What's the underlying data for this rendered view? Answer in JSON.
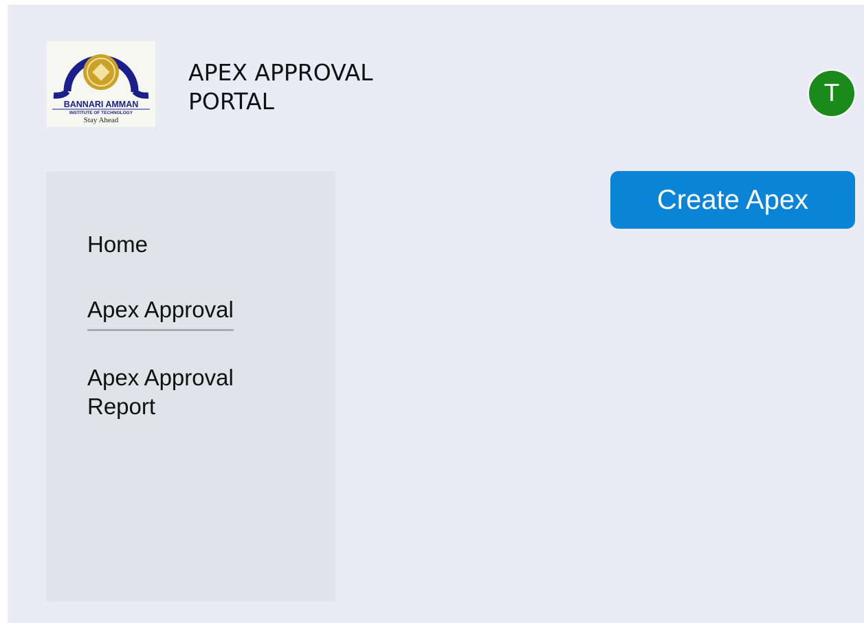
{
  "header": {
    "logo": {
      "icon": "omega-logo-icon",
      "name": "BANNARI AMMAN",
      "subtitle": "INSTITUTE OF TECHNOLOGY",
      "tagline": "Stay Ahead"
    },
    "title": "APEX APPROVAL\nPORTAL",
    "avatar_initial": "T",
    "avatar_color": "#1a8a1a"
  },
  "sidebar": {
    "items": [
      {
        "label": "Home",
        "active": false
      },
      {
        "label": "Apex Approval",
        "active": true
      },
      {
        "label": "Apex Approval\nReport",
        "active": false
      }
    ]
  },
  "main": {
    "create_button_label": "Create Apex",
    "accent_color": "#0a84d6"
  }
}
